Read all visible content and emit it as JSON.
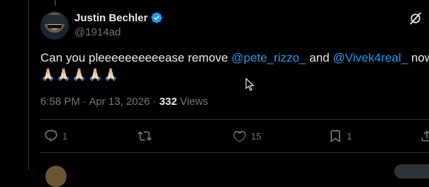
{
  "author": {
    "name": "Justin Bechler",
    "handle": "@1914ad"
  },
  "tweet": {
    "segments": [
      {
        "text": "Can you pleeeeeeeeeease remove ",
        "type": "text"
      },
      {
        "text": "@pete_rizzo_",
        "type": "mention"
      },
      {
        "text": " and ",
        "type": "text"
      },
      {
        "text": "@Vivek4real_",
        "type": "mention"
      },
      {
        "text": " now?",
        "type": "text"
      }
    ],
    "emojis": "🙏🏻🙏🏻🙏🏻🙏🏻🙏🏻"
  },
  "meta": {
    "time": "6:58 PM",
    "separator": " · ",
    "date": "Apr 13, 2026",
    "views_count": "332",
    "views_label": "Views"
  },
  "actions": {
    "reply": {
      "icon": "reply-icon",
      "count": "1"
    },
    "retweet": {
      "icon": "retweet-icon",
      "count": ""
    },
    "like": {
      "icon": "heart-icon",
      "count": "15"
    },
    "bookmark": {
      "icon": "bookmark-icon",
      "count": "1"
    },
    "share": {
      "icon": "share-icon",
      "count": ""
    }
  },
  "colors": {
    "background": "#000000",
    "text": "#e7e9ea",
    "muted": "#71767b",
    "accent": "#1d9bf0",
    "border": "#2f3336"
  }
}
